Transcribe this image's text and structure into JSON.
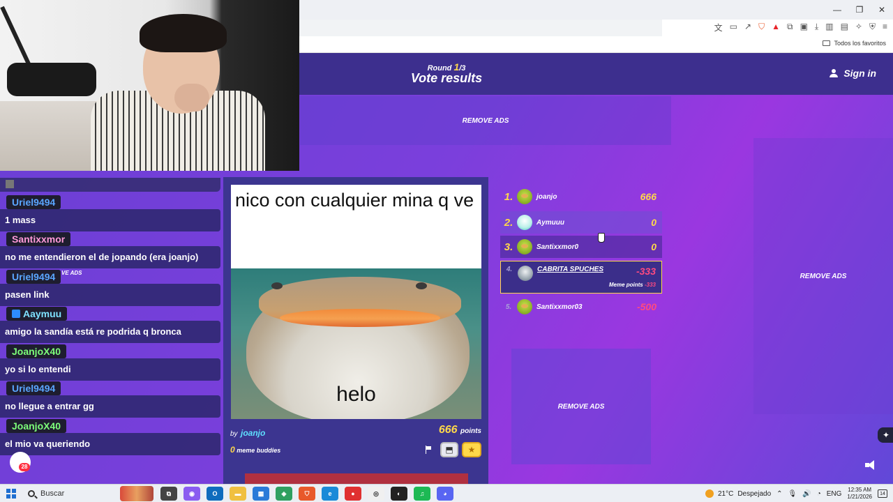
{
  "browser": {
    "bookmarks_all": "Todos los favoritos",
    "window_controls": [
      "—",
      "❐",
      "✕"
    ],
    "toolbar_icons": [
      "translate-icon",
      "cast-icon",
      "share-icon",
      "brave-shield-icon",
      "brave-rewards-icon",
      "extensions-icon",
      "tab-search-icon",
      "downloads-icon",
      "sidebar-icon",
      "wallet-icon",
      "leo-icon",
      "vpn-icon",
      "menu-icon"
    ]
  },
  "site": {
    "round": {
      "word": "Round",
      "current": "1",
      "total": "/3"
    },
    "title": "Vote results",
    "sign_in": "Sign in",
    "remove_ads": "REMOVE ADS"
  },
  "meme": {
    "caption": "nico con cualquier mina q ve",
    "image_text": "helo",
    "by": "by",
    "author": "joanjo",
    "points": "666",
    "points_unit": "points",
    "buddies_count": "0",
    "buddies_label": "meme buddies"
  },
  "leaderboard": [
    {
      "rank": "1.",
      "name": "joanjo",
      "score": "666",
      "avatar": "green"
    },
    {
      "rank": "2.",
      "name": "Aymuuu",
      "score": "0",
      "avatar": "teal"
    },
    {
      "rank": "3.",
      "name": "Santixxmor0",
      "score": "0",
      "avatar": "green"
    },
    {
      "rank": "4.",
      "name": "CABRITA SPUCHES",
      "score": "-333",
      "avatar": "grey",
      "sub_label": "Meme points",
      "sub_value": "-333"
    },
    {
      "rank": "5.",
      "name": "Santixxmor03",
      "score": "-500",
      "avatar": "green"
    }
  ],
  "chat": {
    "messages": [
      {
        "user": "Uriel9494",
        "text": "1 mass",
        "color": "#5aa6ff"
      },
      {
        "user": "Santixxmor",
        "text": "no me entendieron el de jopando (era joanjo)",
        "color": "#ff9ad8"
      },
      {
        "user": "Uriel9494",
        "text": "pasen link",
        "color": "#5aa6ff"
      },
      {
        "user": "Aaymuu",
        "text": "amigo la sandía está re podrida q bronca",
        "color": "#7fe2ff",
        "badge": true
      },
      {
        "user": "JoanjoX40",
        "text": "yo si lo entendi",
        "color": "#7dff7a"
      },
      {
        "user": "Uriel9494",
        "text": "no llegue a entrar gg",
        "color": "#5aa6ff"
      },
      {
        "user": "JoanjoX40",
        "text": "el mio va queriendo",
        "color": "#7dff7a"
      }
    ],
    "ads_overlay": "VE ADS",
    "unread_badge": "28"
  },
  "taskbar": {
    "search_placeholder": "Buscar",
    "weather_temp": "21°C",
    "weather_text": "Despejado",
    "language": "ENG",
    "time": "12:35 AM",
    "date": "1/21/2026",
    "notification_count": "14"
  },
  "colors": {
    "accent_yellow": "#ffd84a",
    "negative_pink": "#ff4a80",
    "header_purple": "#3d2f8e",
    "author_cyan": "#5ee0ff"
  }
}
